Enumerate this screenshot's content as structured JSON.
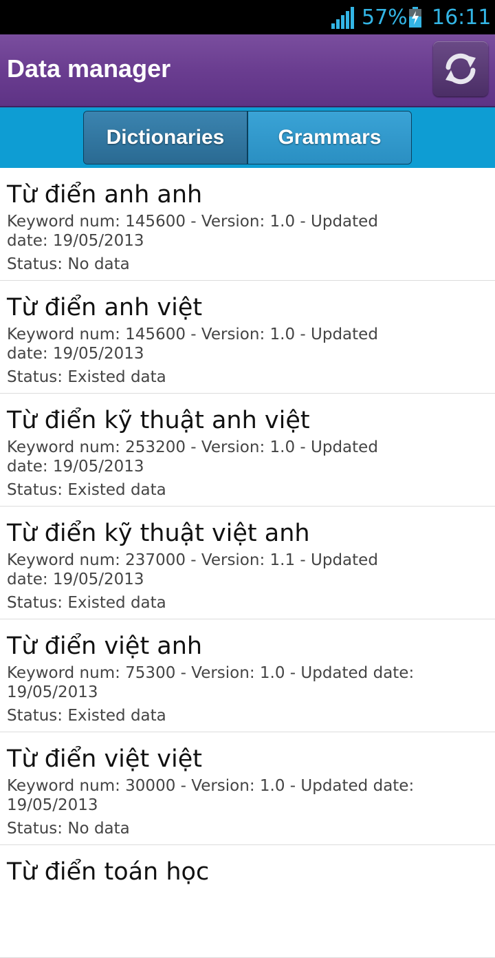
{
  "status_bar": {
    "battery_percent": "57%",
    "time": "16:11",
    "icons": [
      "signal-icon",
      "battery-charging-icon"
    ],
    "accent_color": "#33b5e5"
  },
  "app_bar": {
    "title": "Data manager",
    "refresh_icon": "refresh-icon",
    "background_color": "#6a3d90"
  },
  "tabs": {
    "items": [
      {
        "label": "Dictionaries",
        "selected": true
      },
      {
        "label": "Grammars",
        "selected": false
      }
    ],
    "background_color": "#0e9dd3"
  },
  "list": {
    "items": [
      {
        "title": "Từ điển anh anh",
        "info": "Keyword num: 145600 - Version: 1.0 - Updated date: 19/05/2013",
        "status": "Status: No data"
      },
      {
        "title": "Từ điển anh việt",
        "info": "Keyword num: 145600 - Version: 1.0 - Updated date: 19/05/2013",
        "status": "Status: Existed data"
      },
      {
        "title": "Từ điển kỹ thuật anh việt",
        "info": "Keyword num: 253200 - Version: 1.0 - Updated date: 19/05/2013",
        "status": "Status: Existed data"
      },
      {
        "title": "Từ điển kỹ thuật việt anh",
        "info": "Keyword num: 237000 - Version: 1.1 - Updated date: 19/05/2013",
        "status": "Status: Existed data"
      },
      {
        "title": "Từ điển việt anh",
        "info": "Keyword num: 75300 - Version: 1.0 - Updated date: 19/05/2013",
        "status": "Status: Existed data"
      },
      {
        "title": "Từ điển việt việt",
        "info": "Keyword num: 30000 - Version: 1.0 - Updated date: 19/05/2013",
        "status": "Status: No data"
      },
      {
        "title": "Từ điển toán học",
        "info": "",
        "status": ""
      }
    ]
  }
}
